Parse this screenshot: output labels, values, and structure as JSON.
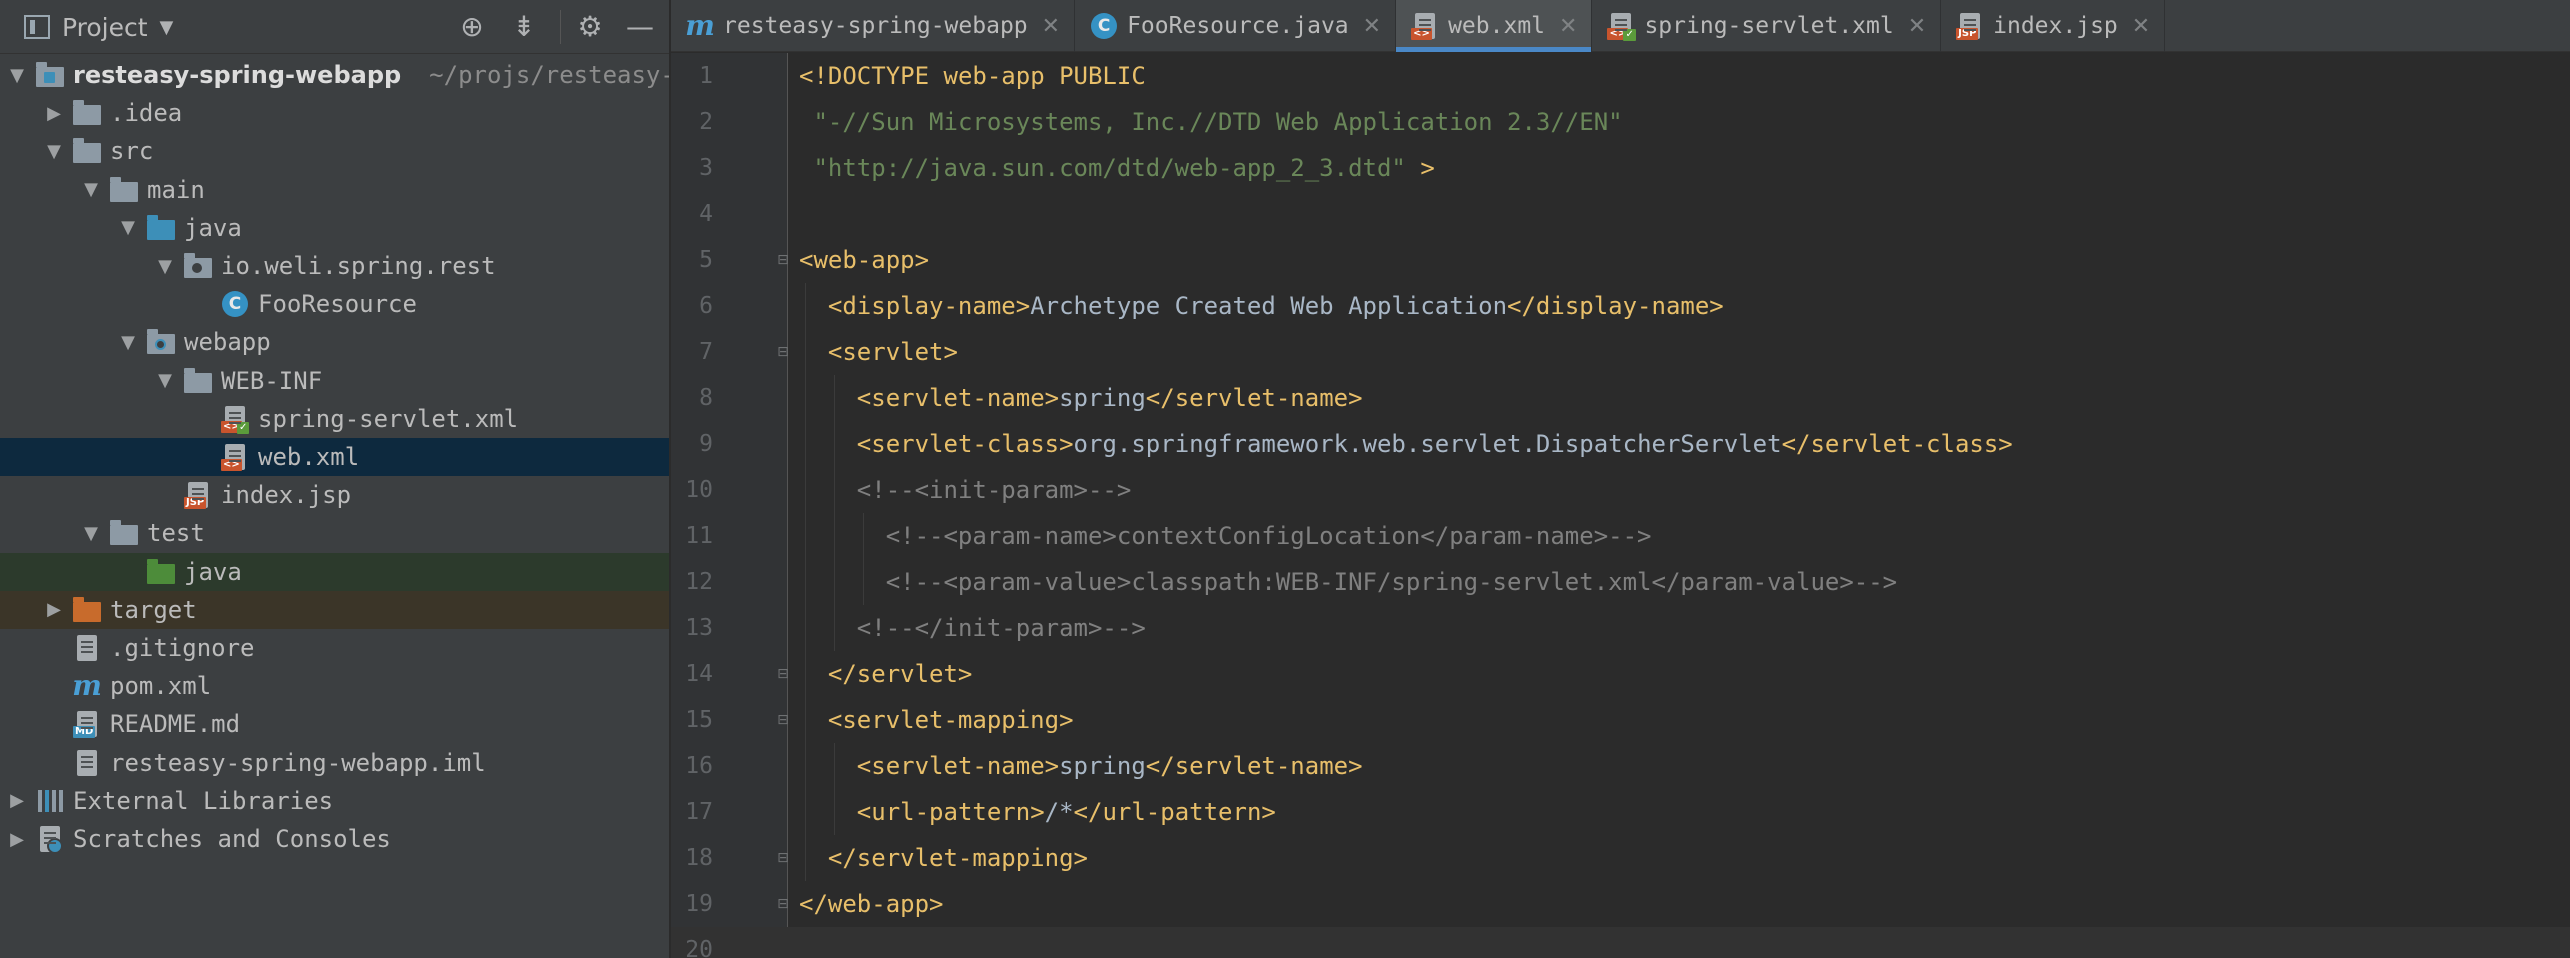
{
  "project_panel": {
    "title": "Project",
    "tree": [
      {
        "label": "resteasy-spring-webapp",
        "path": "~/projs/resteasy-s",
        "icon": "module-folder-icon",
        "expand": "expanded",
        "depth": 0
      },
      {
        "label": ".idea",
        "icon": "folder-icon",
        "expand": "collapsed",
        "depth": 1
      },
      {
        "label": "src",
        "icon": "folder-icon",
        "expand": "expanded",
        "depth": 1
      },
      {
        "label": "main",
        "icon": "folder-icon",
        "expand": "expanded",
        "depth": 2
      },
      {
        "label": "java",
        "icon": "source-folder-icon",
        "expand": "expanded",
        "depth": 3
      },
      {
        "label": "io.weli.spring.rest",
        "icon": "package-icon",
        "expand": "expanded",
        "depth": 4
      },
      {
        "label": "FooResource",
        "icon": "class-icon",
        "expand": "none",
        "depth": 5
      },
      {
        "label": "webapp",
        "icon": "web-folder-icon",
        "expand": "expanded",
        "depth": 3
      },
      {
        "label": "WEB-INF",
        "icon": "folder-icon",
        "expand": "expanded",
        "depth": 4
      },
      {
        "label": "spring-servlet.xml",
        "icon": "spring-xml-icon",
        "expand": "none",
        "depth": 5
      },
      {
        "label": "web.xml",
        "icon": "web-xml-icon",
        "expand": "none",
        "depth": 5,
        "selected": true
      },
      {
        "label": "index.jsp",
        "icon": "jsp-file-icon",
        "expand": "none",
        "depth": 4
      },
      {
        "label": "test",
        "icon": "folder-icon",
        "expand": "expanded",
        "depth": 2
      },
      {
        "label": "java",
        "icon": "test-source-folder-icon",
        "expand": "none",
        "depth": 3
      },
      {
        "label": "target",
        "icon": "excluded-folder-icon",
        "expand": "collapsed",
        "depth": 1
      },
      {
        "label": ".gitignore",
        "icon": "text-file-icon",
        "expand": "none",
        "depth": 1
      },
      {
        "label": "pom.xml",
        "icon": "maven-icon",
        "expand": "none",
        "depth": 1
      },
      {
        "label": "README.md",
        "icon": "markdown-file-icon",
        "expand": "none",
        "depth": 1
      },
      {
        "label": "resteasy-spring-webapp.iml",
        "icon": "iml-file-icon",
        "expand": "none",
        "depth": 1
      },
      {
        "label": "External Libraries",
        "icon": "libraries-icon",
        "expand": "collapsed",
        "depth": 0
      },
      {
        "label": "Scratches and Consoles",
        "icon": "scratches-icon",
        "expand": "collapsed",
        "depth": 0
      }
    ]
  },
  "tabs": [
    {
      "label": "resteasy-spring-webapp",
      "icon": "maven-icon",
      "active": false
    },
    {
      "label": "FooResource.java",
      "icon": "class-icon",
      "active": false
    },
    {
      "label": "web.xml",
      "icon": "web-xml-icon",
      "active": true
    },
    {
      "label": "spring-servlet.xml",
      "icon": "spring-xml-icon",
      "active": false
    },
    {
      "label": "index.jsp",
      "icon": "jsp-file-icon",
      "active": false
    }
  ],
  "editor": {
    "current_line": 20,
    "lines": [
      {
        "n": "1",
        "indent": 0,
        "fold": "",
        "parts": [
          [
            "tag",
            "<!DOCTYPE web-app PUBLIC"
          ]
        ]
      },
      {
        "n": "2",
        "indent": 0,
        "fold": "",
        "parts": [
          [
            "str",
            " \"-//Sun Microsystems, Inc.//DTD Web Application 2.3//EN\""
          ]
        ]
      },
      {
        "n": "3",
        "indent": 0,
        "fold": "",
        "parts": [
          [
            "str",
            " \"http://java.sun.com/dtd/web-app_2_3.dtd\""
          ],
          [
            "tag",
            " >"
          ]
        ]
      },
      {
        "n": "4",
        "indent": 0,
        "fold": "",
        "parts": []
      },
      {
        "n": "5",
        "indent": 0,
        "fold": "open",
        "parts": [
          [
            "tag",
            "<web-app>"
          ]
        ]
      },
      {
        "n": "6",
        "indent": 1,
        "fold": "",
        "parts": [
          [
            "tag",
            "<display-name>"
          ],
          [
            "text",
            "Archetype Created Web Application"
          ],
          [
            "tag",
            "</display-name>"
          ]
        ]
      },
      {
        "n": "7",
        "indent": 1,
        "fold": "open",
        "parts": [
          [
            "tag",
            "<servlet>"
          ]
        ]
      },
      {
        "n": "8",
        "indent": 2,
        "fold": "",
        "parts": [
          [
            "tag",
            "<servlet-name>"
          ],
          [
            "text",
            "spring"
          ],
          [
            "tag",
            "</servlet-name>"
          ]
        ]
      },
      {
        "n": "9",
        "indent": 2,
        "fold": "",
        "parts": [
          [
            "tag",
            "<servlet-class>"
          ],
          [
            "text",
            "org.springframework.web.servlet.DispatcherServlet"
          ],
          [
            "tag",
            "</servlet-class>"
          ]
        ]
      },
      {
        "n": "10",
        "indent": 2,
        "fold": "",
        "parts": [
          [
            "cmt",
            "<!--<init-param>-->"
          ]
        ]
      },
      {
        "n": "11",
        "indent": 3,
        "fold": "",
        "parts": [
          [
            "cmt",
            "<!--<param-name>contextConfigLocation</param-name>-->"
          ]
        ]
      },
      {
        "n": "12",
        "indent": 3,
        "fold": "",
        "parts": [
          [
            "cmt",
            "<!--<param-value>classpath:WEB-INF/spring-servlet.xml</param-value>-->"
          ]
        ]
      },
      {
        "n": "13",
        "indent": 2,
        "fold": "",
        "parts": [
          [
            "cmt",
            "<!--</init-param>-->"
          ]
        ]
      },
      {
        "n": "14",
        "indent": 1,
        "fold": "close",
        "parts": [
          [
            "tag",
            "</servlet>"
          ]
        ]
      },
      {
        "n": "15",
        "indent": 1,
        "fold": "open",
        "parts": [
          [
            "tag",
            "<servlet-mapping>"
          ]
        ]
      },
      {
        "n": "16",
        "indent": 2,
        "fold": "",
        "parts": [
          [
            "tag",
            "<servlet-name>"
          ],
          [
            "text",
            "spring"
          ],
          [
            "tag",
            "</servlet-name>"
          ]
        ]
      },
      {
        "n": "17",
        "indent": 2,
        "fold": "",
        "parts": [
          [
            "tag",
            "<url-pattern>"
          ],
          [
            "text",
            "/*"
          ],
          [
            "tag",
            "</url-pattern>"
          ]
        ]
      },
      {
        "n": "18",
        "indent": 1,
        "fold": "close",
        "parts": [
          [
            "tag",
            "</servlet-mapping>"
          ]
        ]
      },
      {
        "n": "19",
        "indent": 0,
        "fold": "close",
        "parts": [
          [
            "tag",
            "</web-app>"
          ]
        ]
      },
      {
        "n": "20",
        "indent": 0,
        "fold": "",
        "parts": []
      }
    ]
  },
  "colors": {
    "tag": "#e8bf6a",
    "text": "#a9b7c6",
    "string": "#6a8759",
    "comment": "#808080",
    "selection": "#0d293e",
    "active_tab_underline": "#4a88c7"
  }
}
